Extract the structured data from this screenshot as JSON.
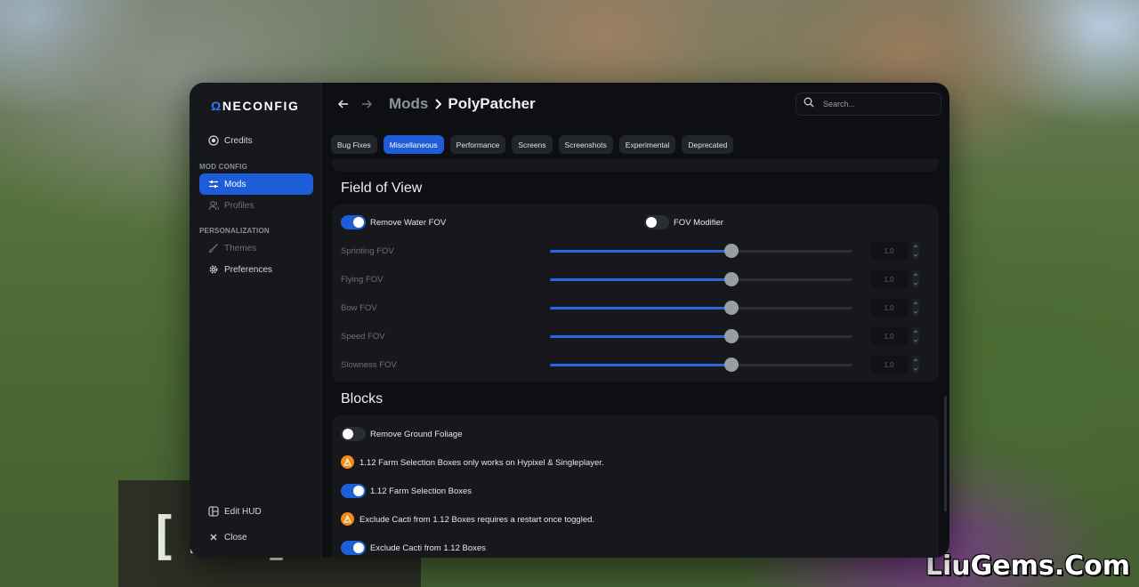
{
  "background": {
    "block_text": "[F ] ",
    "watermark": "LiuGems.Com"
  },
  "sidebar": {
    "logo_prefix": "Ω",
    "logo_rest": "NECONFIG",
    "credits": "Credits",
    "mod_config_heading": "MOD CONFIG",
    "mods": "Mods",
    "profiles": "Profiles",
    "personalization_heading": "PERSONALIZATION",
    "themes": "Themes",
    "preferences": "Preferences",
    "edit_hud": "Edit HUD",
    "close": "Close"
  },
  "header": {
    "crumb_parent": "Mods",
    "crumb_current": "PolyPatcher",
    "search_placeholder": "Search..."
  },
  "tabs": [
    {
      "label": "Bug Fixes",
      "active": false
    },
    {
      "label": "Miscellaneous",
      "active": true
    },
    {
      "label": "Performance",
      "active": false
    },
    {
      "label": "Screens",
      "active": false
    },
    {
      "label": "Screenshots",
      "active": false
    },
    {
      "label": "Experimental",
      "active": false
    },
    {
      "label": "Deprecated",
      "active": false
    }
  ],
  "fov_section": {
    "title": "Field of View",
    "remove_water_fov": {
      "label": "Remove Water FOV",
      "on": true
    },
    "fov_modifier": {
      "label": "FOV Modifier",
      "on": false
    },
    "sliders": [
      {
        "label": "Sprinting FOV",
        "value": "1.0",
        "fraction": 0.6
      },
      {
        "label": "Flying FOV",
        "value": "1.0",
        "fraction": 0.6
      },
      {
        "label": "Bow FOV",
        "value": "1.0",
        "fraction": 0.6
      },
      {
        "label": "Speed FOV",
        "value": "1.0",
        "fraction": 0.6
      },
      {
        "label": "Slowness FOV",
        "value": "1.0",
        "fraction": 0.6
      }
    ]
  },
  "blocks_section": {
    "title": "Blocks",
    "remove_ground_foliage": {
      "label": "Remove Ground Foliage",
      "on": false
    },
    "warning_farm": "1.12 Farm Selection Boxes only works on Hypixel & Singleplayer.",
    "farm_selection_boxes": {
      "label": "1.12 Farm Selection Boxes",
      "on": true
    },
    "warning_cacti": "Exclude Cacti from 1.12 Boxes requires a restart once toggled.",
    "exclude_cacti": {
      "label": "Exclude Cacti from 1.12 Boxes",
      "on": true
    }
  },
  "colors": {
    "accent": "#1d5ed8",
    "window_bg": "#0d0f12",
    "card_bg": "#16181c",
    "warning": "#f08a1b"
  },
  "icons": [
    "credits-icon",
    "mods-sliders-icon",
    "profiles-icon",
    "themes-brush-icon",
    "preferences-gear-icon",
    "edit-hud-icon",
    "close-icon",
    "back-arrow-icon",
    "forward-arrow-icon",
    "chevron-right-icon",
    "search-icon",
    "warning-icon"
  ]
}
